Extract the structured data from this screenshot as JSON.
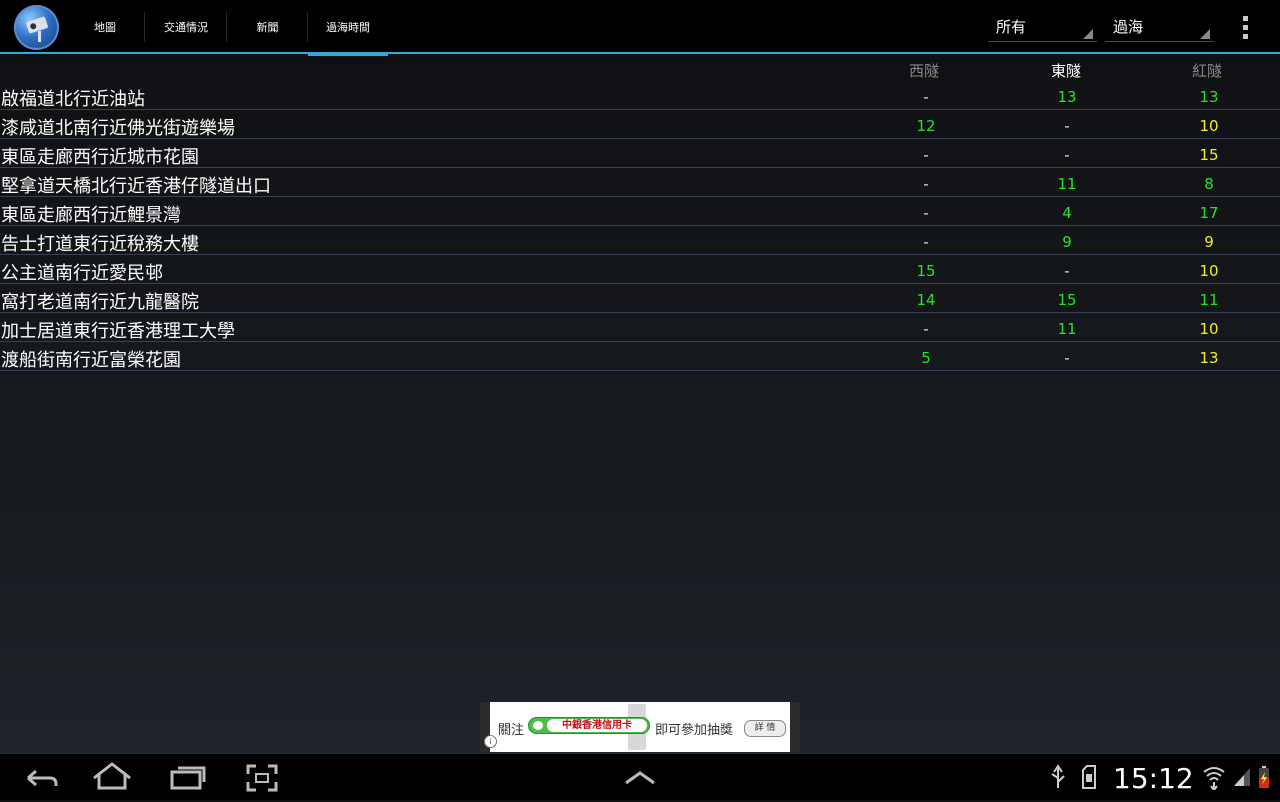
{
  "actionbar": {
    "tabs": [
      {
        "label": "地圖",
        "active": false
      },
      {
        "label": "交通情況",
        "active": false
      },
      {
        "label": "新聞",
        "active": false
      },
      {
        "label": "過海時間",
        "active": true
      }
    ],
    "spinner_area": "所有",
    "spinner_type": "過海",
    "accent_color": "#33a9d8"
  },
  "table": {
    "headers": {
      "west": "西隧",
      "east": "東隧",
      "red": "紅隧"
    },
    "rows": [
      {
        "name": "啟福道北行近油站",
        "west": "-",
        "east": "13",
        "red": "13"
      },
      {
        "name": "漆咸道北南行近佛光街遊樂場",
        "west": "12",
        "east": "-",
        "red": "10"
      },
      {
        "name": "東區走廊西行近城市花園",
        "west": "-",
        "east": "-",
        "red": "15"
      },
      {
        "name": "堅拿道天橋北行近香港仔隧道出口",
        "west": "-",
        "east": "11",
        "red": "8"
      },
      {
        "name": "東區走廊西行近鯉景灣",
        "west": "-",
        "east": "4",
        "red": "17"
      },
      {
        "name": "告士打道東行近稅務大樓",
        "west": "-",
        "east": "9",
        "red": "9"
      },
      {
        "name": "公主道南行近愛民邨",
        "west": "15",
        "east": "-",
        "red": "10"
      },
      {
        "name": "窩打老道南行近九龍醫院",
        "west": "14",
        "east": "15",
        "red": "11"
      },
      {
        "name": "加士居道東行近香港理工大學",
        "west": "-",
        "east": "11",
        "red": "10"
      },
      {
        "name": "渡船街南行近富榮花園",
        "west": "5",
        "east": "-",
        "red": "13"
      }
    ],
    "colors": {
      "green": "#27e22c",
      "yellow": "#f2ef1e"
    }
  },
  "ad": {
    "text_before": "關注",
    "pill_text": "中銀香港信用卡",
    "text_after": "即可參加抽獎",
    "detail_button": "詳 情",
    "info_icon": "info-icon"
  },
  "navbar": {
    "icons": [
      "back-icon",
      "home-icon",
      "recent-apps-icon",
      "screenshot-icon",
      "up-chevron-icon"
    ],
    "clock": "15:12",
    "status_icons": [
      "usb-icon",
      "sdcard-icon",
      "wifi-icon",
      "signal-icon",
      "battery-icon"
    ]
  }
}
